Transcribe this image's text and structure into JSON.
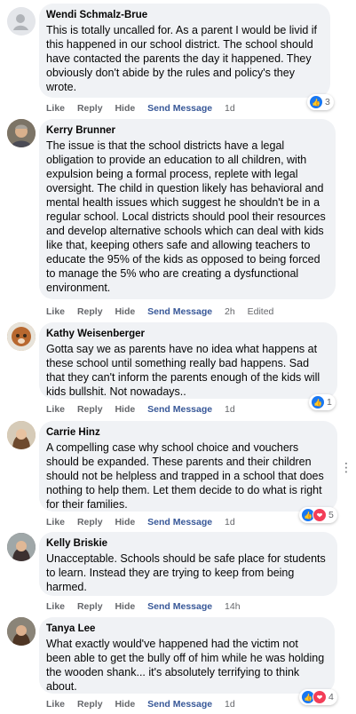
{
  "comments": [
    {
      "author": "Wendi Schmalz-Brue",
      "text": "This is totally uncalled for. As a parent I would be livid if this happened in our school district. The school should have contacted the parents the day it happened. They obviously don't abide by the rules and policy's they wrote.",
      "actions": {
        "like": "Like",
        "reply": "Reply",
        "hide": "Hide",
        "send": "Send Message",
        "time": "1d"
      },
      "reactions": {
        "types": [
          "like"
        ],
        "count": "3"
      }
    },
    {
      "author": "Kerry Brunner",
      "text": "The issue is that the school districts have a legal obligation to provide an education to all children, with expulsion being a formal process, replete with legal oversight. The child in question likely has behavioral and mental health issues which suggest he shouldn't be in a regular school. Local districts should pool their resources and develop alternative schools which can deal with kids like that, keeping others safe and allowing teachers to educate the 95% of the kids as opposed to being forced to manage the 5% who are creating a dysfunctional environment.",
      "actions": {
        "like": "Like",
        "reply": "Reply",
        "hide": "Hide",
        "send": "Send Message",
        "time": "2h",
        "edited": "Edited"
      }
    },
    {
      "author": "Kathy Weisenberger",
      "text": "Gotta say we as parents have no idea what happens at these school until something really bad happens. Sad that they can't inform the parents enough of the kids will kids bullshit. Not nowadays..",
      "actions": {
        "like": "Like",
        "reply": "Reply",
        "hide": "Hide",
        "send": "Send Message",
        "time": "1d"
      },
      "reactions": {
        "types": [
          "like"
        ],
        "count": "1"
      }
    },
    {
      "author": "Carrie Hinz",
      "text": "A compelling case why school choice and vouchers should be expanded. These parents and their children should not be helpless and trapped in a school that does nothing to help them. Let them decide to do what is right for their families.",
      "actions": {
        "like": "Like",
        "reply": "Reply",
        "hide": "Hide",
        "send": "Send Message",
        "time": "1d"
      },
      "reactions": {
        "types": [
          "like",
          "love"
        ],
        "count": "5"
      }
    },
    {
      "author": "Kelly Briskie",
      "text": "Unacceptable. Schools should be safe place for students to learn. Instead they are trying to keep from being harmed.",
      "actions": {
        "like": "Like",
        "reply": "Reply",
        "hide": "Hide",
        "send": "Send Message",
        "time": "14h"
      }
    },
    {
      "author": "Tanya Lee",
      "text": "What exactly would've happened had the victim not been able to get the bully off of him while he was holding the wooden shank... it's absolutely terrifying to think about.",
      "actions": {
        "like": "Like",
        "reply": "Reply",
        "hide": "Hide",
        "send": "Send Message",
        "time": "1d"
      },
      "reactions": {
        "types": [
          "like",
          "love"
        ],
        "count": "4"
      }
    }
  ],
  "colors": {
    "bubble": "#f0f2f5",
    "muted": "#65676b",
    "link": "#385898",
    "like": "#1877f2",
    "love": "#f33e58"
  },
  "icons": {
    "like": "thumbs-up-icon",
    "love": "heart-icon",
    "more": "more-dots-icon"
  }
}
